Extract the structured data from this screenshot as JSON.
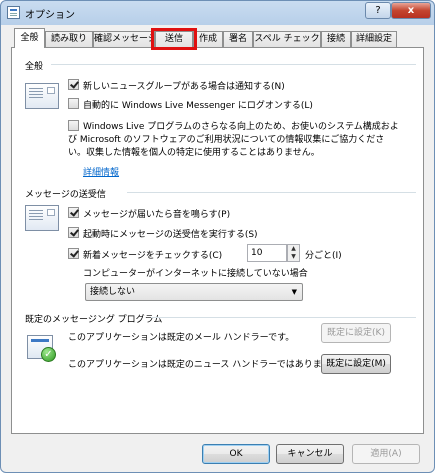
{
  "window": {
    "title": "オプション",
    "help_label": "?",
    "close_label": "x"
  },
  "tabs": [
    {
      "label": "全般"
    },
    {
      "label": "読み取り"
    },
    {
      "label": "確認メッセージ"
    },
    {
      "label": "送信"
    },
    {
      "label": "作成"
    },
    {
      "label": "署名"
    },
    {
      "label": "スペル チェック"
    },
    {
      "label": "接続"
    },
    {
      "label": "詳細設定"
    }
  ],
  "general": {
    "title": "全般",
    "notify_newsgroups": {
      "label": "新しいニュースグループがある場合は通知する(N)",
      "checked": true
    },
    "auto_signin": {
      "label": "自動的に Windows Live Messenger にログオンする(L)",
      "checked": false
    },
    "improvement": {
      "line1": "Windows Live プログラムのさらなる向上のため、お使いのシステム構成およ",
      "line2": "び Microsoft のソフトウェアのご利用状況についての情報収集にご協力くださ",
      "line3": "い。収集した情報を個人の特定に使用することはありません。",
      "checked": false
    },
    "details_link": "詳細情報"
  },
  "send_receive": {
    "title": "メッセージの送受信",
    "play_sound": {
      "label": "メッセージが届いたら音を鳴らす(P)",
      "checked": true
    },
    "send_at_startup": {
      "label": "起動時にメッセージの送受信を実行する(S)",
      "checked": true
    },
    "check_new": {
      "label": "新着メッセージをチェックする(C)",
      "checked": true
    },
    "interval_value": "10",
    "interval_unit": "分ごと(I)",
    "offline_label": "コンピューターがインターネットに接続していない場合",
    "offline_selected": "接続しない"
  },
  "default_program": {
    "title": "既定のメッセージング プログラム",
    "mail_text": "このアプリケーションは既定のメール ハンドラーです。",
    "mail_button": "既定に設定(K)",
    "news_text": "このアプリケーションは既定のニュース ハンドラーではありません。",
    "news_button": "既定に設定(M)"
  },
  "footer": {
    "ok": "OK",
    "cancel": "キャンセル",
    "apply": "適用(A)"
  }
}
